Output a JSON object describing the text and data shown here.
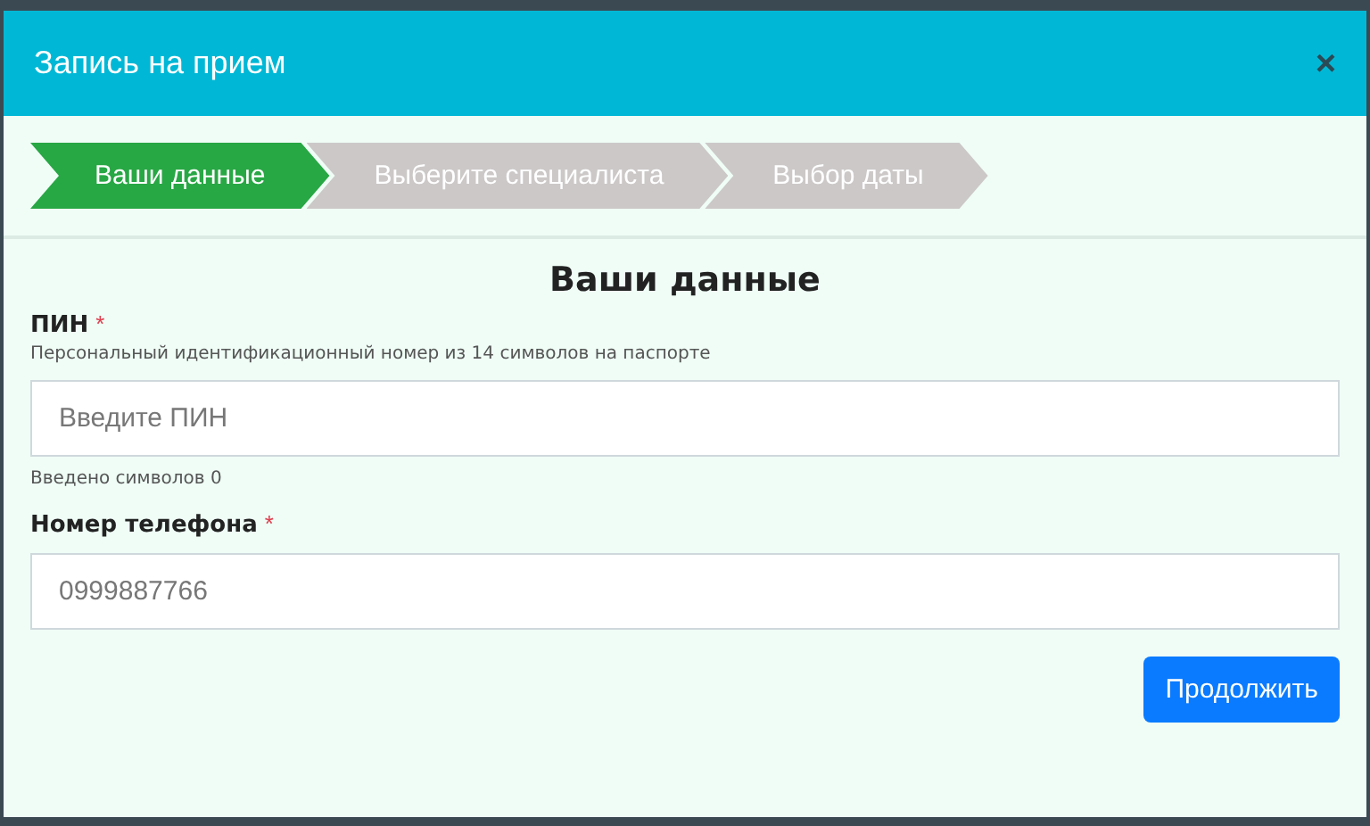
{
  "dialog": {
    "title": "Запись на прием",
    "close": "×"
  },
  "steps": [
    {
      "label": "Ваши данные",
      "selected": true
    },
    {
      "label": "Выберите специалиста",
      "selected": false
    },
    {
      "label": "Выбор даты",
      "selected": false
    }
  ],
  "form": {
    "heading": "Ваши данные",
    "fields": [
      {
        "label": "ПИН",
        "required_mark": "*",
        "hint": "Персональный идентификационный номер из 14 символов на паспорте",
        "placeholder": "Введите ПИН",
        "counter": "Введено символов 0"
      },
      {
        "label": "Номер телефона",
        "required_mark": "*",
        "placeholder": "0999887766"
      }
    ],
    "submit": "Продолжить"
  }
}
